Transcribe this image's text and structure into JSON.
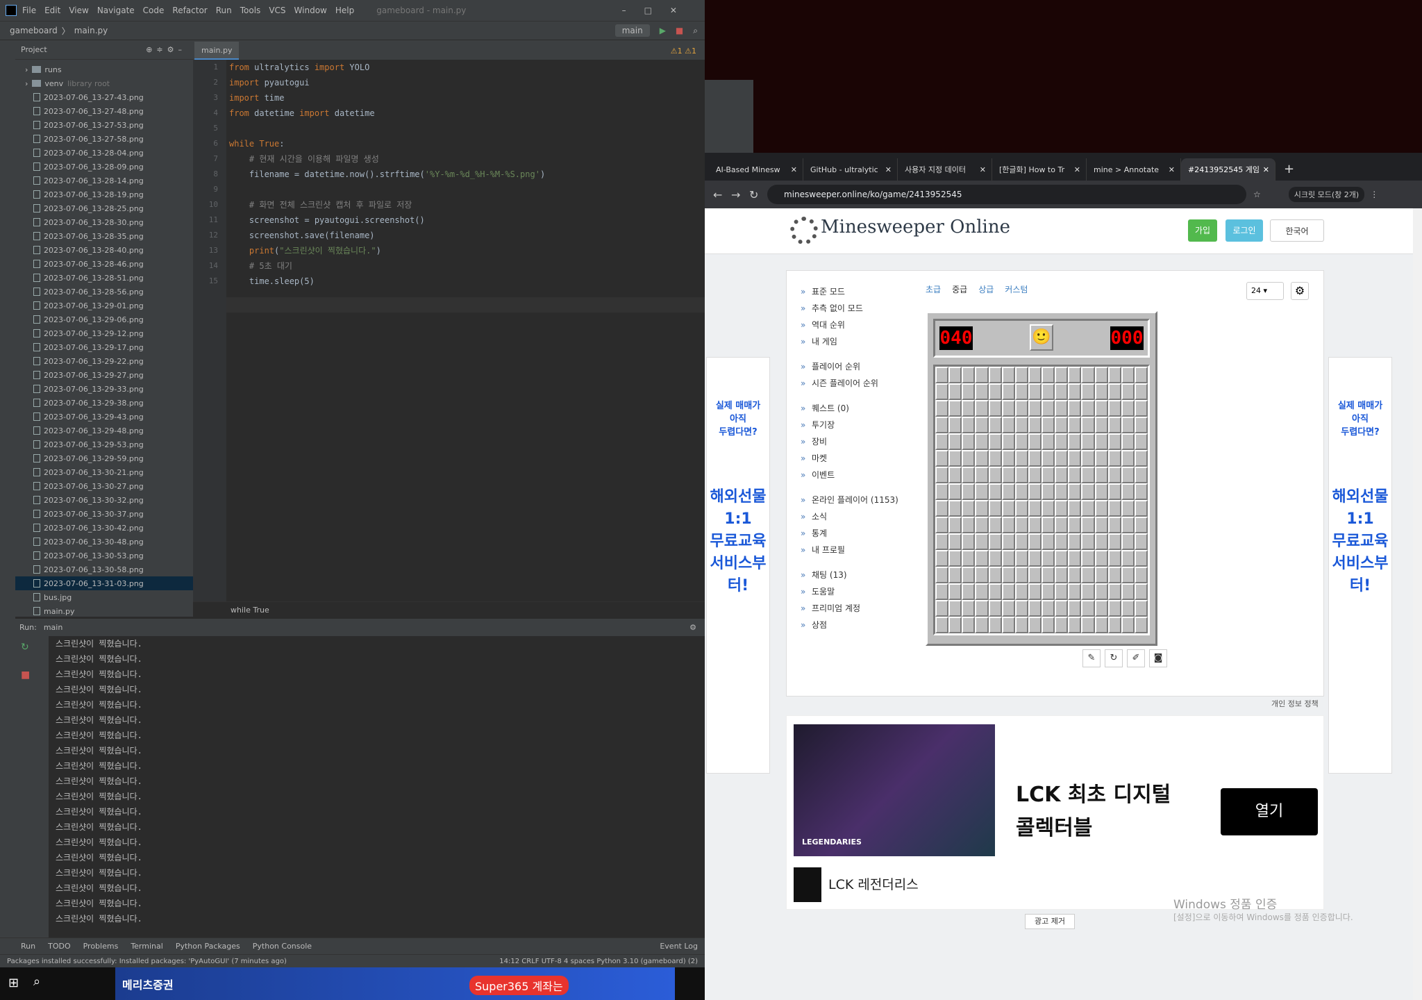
{
  "ide": {
    "menu": [
      "File",
      "Edit",
      "View",
      "Navigate",
      "Code",
      "Refactor",
      "Run",
      "Tools",
      "VCS",
      "Window",
      "Help"
    ],
    "window_title": "gameboard - main.py",
    "breadcrumb": [
      "gameboard",
      "main.py"
    ],
    "run_config": "main",
    "project_label": "Project",
    "tree": [
      {
        "type": "folder",
        "name": "runs"
      },
      {
        "type": "folder",
        "name": "venv",
        "note": "library root"
      },
      {
        "type": "file",
        "name": "2023-07-06_13-27-43.png"
      },
      {
        "type": "file",
        "name": "2023-07-06_13-27-48.png"
      },
      {
        "type": "file",
        "name": "2023-07-06_13-27-53.png"
      },
      {
        "type": "file",
        "name": "2023-07-06_13-27-58.png"
      },
      {
        "type": "file",
        "name": "2023-07-06_13-28-04.png"
      },
      {
        "type": "file",
        "name": "2023-07-06_13-28-09.png"
      },
      {
        "type": "file",
        "name": "2023-07-06_13-28-14.png"
      },
      {
        "type": "file",
        "name": "2023-07-06_13-28-19.png"
      },
      {
        "type": "file",
        "name": "2023-07-06_13-28-25.png"
      },
      {
        "type": "file",
        "name": "2023-07-06_13-28-30.png"
      },
      {
        "type": "file",
        "name": "2023-07-06_13-28-35.png"
      },
      {
        "type": "file",
        "name": "2023-07-06_13-28-40.png"
      },
      {
        "type": "file",
        "name": "2023-07-06_13-28-46.png"
      },
      {
        "type": "file",
        "name": "2023-07-06_13-28-51.png"
      },
      {
        "type": "file",
        "name": "2023-07-06_13-28-56.png"
      },
      {
        "type": "file",
        "name": "2023-07-06_13-29-01.png"
      },
      {
        "type": "file",
        "name": "2023-07-06_13-29-06.png"
      },
      {
        "type": "file",
        "name": "2023-07-06_13-29-12.png"
      },
      {
        "type": "file",
        "name": "2023-07-06_13-29-17.png"
      },
      {
        "type": "file",
        "name": "2023-07-06_13-29-22.png"
      },
      {
        "type": "file",
        "name": "2023-07-06_13-29-27.png"
      },
      {
        "type": "file",
        "name": "2023-07-06_13-29-33.png"
      },
      {
        "type": "file",
        "name": "2023-07-06_13-29-38.png"
      },
      {
        "type": "file",
        "name": "2023-07-06_13-29-43.png"
      },
      {
        "type": "file",
        "name": "2023-07-06_13-29-48.png"
      },
      {
        "type": "file",
        "name": "2023-07-06_13-29-53.png"
      },
      {
        "type": "file",
        "name": "2023-07-06_13-29-59.png"
      },
      {
        "type": "file",
        "name": "2023-07-06_13-30-21.png"
      },
      {
        "type": "file",
        "name": "2023-07-06_13-30-27.png"
      },
      {
        "type": "file",
        "name": "2023-07-06_13-30-32.png"
      },
      {
        "type": "file",
        "name": "2023-07-06_13-30-37.png"
      },
      {
        "type": "file",
        "name": "2023-07-06_13-30-42.png"
      },
      {
        "type": "file",
        "name": "2023-07-06_13-30-48.png"
      },
      {
        "type": "file",
        "name": "2023-07-06_13-30-53.png"
      },
      {
        "type": "file",
        "name": "2023-07-06_13-30-58.png"
      },
      {
        "type": "file",
        "name": "2023-07-06_13-31-03.png",
        "selected": true
      },
      {
        "type": "file",
        "name": "bus.jpg"
      },
      {
        "type": "file",
        "name": "main.py"
      }
    ],
    "editor_tab": "main.py",
    "code_lines": [
      [
        [
          "kw",
          "from"
        ],
        [
          "fn",
          " ultralytics "
        ],
        [
          "kw",
          "import"
        ],
        [
          "fn",
          " YOLO"
        ]
      ],
      [
        [
          "kw",
          "import"
        ],
        [
          "fn",
          " pyautogui"
        ]
      ],
      [
        [
          "kw",
          "import"
        ],
        [
          "fn",
          " time"
        ]
      ],
      [
        [
          "kw",
          "from"
        ],
        [
          "fn",
          " datetime "
        ],
        [
          "kw",
          "import"
        ],
        [
          "fn",
          " datetime"
        ]
      ],
      [],
      [
        [
          "kw",
          "while"
        ],
        [
          "kw",
          " True"
        ],
        [
          "fn",
          ":"
        ]
      ],
      [
        [
          "cm",
          "    # 현재 시간을 이용해 파일명 생성"
        ]
      ],
      [
        [
          "fn",
          "    filename = datetime.now().strftime("
        ],
        [
          "st",
          "'%Y-%m-%d_%H-%M-%S.png'"
        ],
        [
          "fn",
          ")"
        ]
      ],
      [],
      [
        [
          "cm",
          "    # 화면 전체 스크린샷 캡처 후 파일로 저장"
        ]
      ],
      [
        [
          "fn",
          "    screenshot = pyautogui.screenshot()"
        ]
      ],
      [
        [
          "fn",
          "    screenshot.save(filename)"
        ]
      ],
      [
        [
          "kw",
          "    print"
        ],
        [
          "fn",
          "("
        ],
        [
          "st",
          "\"스크린샷이 찍혔습니다.\""
        ],
        [
          "fn",
          ")"
        ]
      ],
      [
        [
          "cm",
          "    # 5초 대기"
        ]
      ],
      [
        [
          "fn",
          "    time.sleep(5)"
        ]
      ]
    ],
    "editor_crumb": "while True",
    "warnings": "⚠1 ⚠1",
    "run_label": "Run:",
    "run_tab": "main",
    "console_lines": [
      "스크린샷이 찍혔습니다.",
      "스크린샷이 찍혔습니다.",
      "스크린샷이 찍혔습니다.",
      "스크린샷이 찍혔습니다.",
      "스크린샷이 찍혔습니다.",
      "스크린샷이 찍혔습니다.",
      "스크린샷이 찍혔습니다.",
      "스크린샷이 찍혔습니다.",
      "스크린샷이 찍혔습니다.",
      "스크린샷이 찍혔습니다.",
      "스크린샷이 찍혔습니다.",
      "스크린샷이 찍혔습니다.",
      "스크린샷이 찍혔습니다.",
      "스크린샷이 찍혔습니다.",
      "스크린샷이 찍혔습니다.",
      "스크린샷이 찍혔습니다.",
      "스크린샷이 찍혔습니다.",
      "스크린샷이 찍혔습니다.",
      "스크린샷이 찍혔습니다."
    ],
    "bottom_tabs": [
      "Run",
      "TODO",
      "Problems",
      "Terminal",
      "Python Packages",
      "Python Console",
      "Event Log"
    ],
    "status_left": "Packages installed successfully: Installed packages: 'PyAutoGUI' (7 minutes ago)",
    "status_right": "14:12   CRLF   UTF-8   4 spaces   Python 3.10 (gameboard) (2)"
  },
  "taskbar_ad": {
    "brand": "메리츠증권",
    "promo": "Super365 계좌는"
  },
  "browser": {
    "tabs": [
      {
        "label": "AI-Based Minesw",
        "active": false
      },
      {
        "label": "GitHub - ultralytic",
        "active": false
      },
      {
        "label": "사용자 지정 데이터",
        "active": false
      },
      {
        "label": "[한글화] How to Tr",
        "active": false
      },
      {
        "label": "mine > Annotate",
        "active": false
      },
      {
        "label": "#2413952545 게임",
        "active": true
      }
    ],
    "url": "minesweeper.online/ko/game/2413952545",
    "profile": "시크릿 모드(창 2개)"
  },
  "site": {
    "title": "Minesweeper Online",
    "signup": "가입",
    "login": "로그인",
    "language": "한국어",
    "menu": [
      [
        "표준 모드",
        "추측 없이 모드",
        "역대 순위",
        "내 게임"
      ],
      [
        "플레이어 순위",
        "시즌 플레이어 순위"
      ],
      [
        "퀘스트 (0)",
        "투기장",
        "장비",
        "마켓",
        "이벤트"
      ],
      [
        "온라인 플레이어 (1153)",
        "소식",
        "통계",
        "내 프로필"
      ],
      [
        "채팅 (13)",
        "도움말",
        "프리미엄 계정",
        "상점"
      ]
    ],
    "levels": [
      "초급",
      "중급",
      "상급",
      "커스텀"
    ],
    "current_level": "중급",
    "zoom": "24",
    "mine_counter": "040",
    "timer": "000",
    "face": "🙂",
    "privacy": "개인 정보 정책",
    "remove_ad": "광고 제거",
    "side_ad": {
      "line1": "실제 매매가\n아직\n두렵다면?",
      "line2": "해외선물\n1:1\n무료교육\n서비스부터!"
    },
    "big_ad": {
      "headline": "LCK 최초 디지털\n콜렉터블",
      "button": "열기",
      "brand": "LCK 레전더리스",
      "img_caption": "LEGENDARIES"
    },
    "watermark": "Windows 정품 인증",
    "watermark_sub": "[설정]으로 이동하여 Windows를 정품 인증합니다."
  }
}
